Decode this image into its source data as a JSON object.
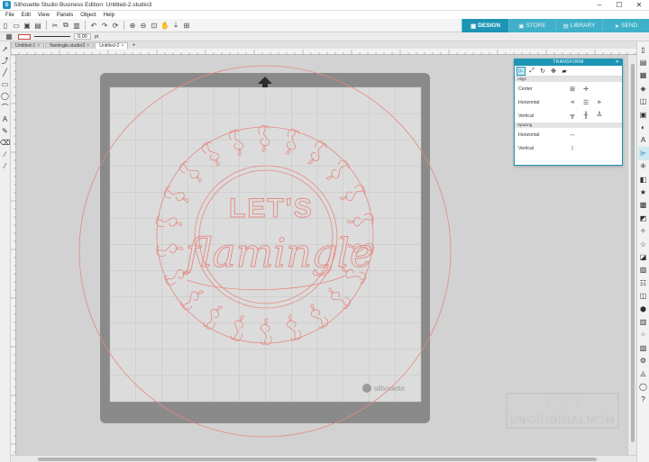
{
  "window": {
    "title": "Silhouette Studio Business Edition: Untitled-2.studio3",
    "controls": [
      "minimize",
      "maximize",
      "close"
    ]
  },
  "menu": [
    "File",
    "Edit",
    "View",
    "Panels",
    "Object",
    "Help"
  ],
  "mode_tabs": [
    {
      "label": "DESIGN",
      "active": true
    },
    {
      "label": "STORE",
      "active": false
    },
    {
      "label": "LIBRARY",
      "active": false
    },
    {
      "label": "SEND",
      "active": false
    }
  ],
  "line_options": {
    "line_width_value": "0.00",
    "unit": "pt"
  },
  "document_tabs": [
    {
      "label": "Untitled-1",
      "active": false
    },
    {
      "label": "flamingle.studio3",
      "active": false
    },
    {
      "label": "Untitled-2",
      "active": true
    }
  ],
  "transform_panel": {
    "title": "TRANSFORM",
    "sections": {
      "align": "Align",
      "spacing": "Spacing"
    },
    "rows": {
      "center": "Center",
      "horizontal": "Horizontal",
      "vertical": "Vertical",
      "space_horizontal": "Horizontal",
      "space_vertical": "Vertical"
    }
  },
  "design": {
    "text_top": "LET'S",
    "text_script": "flamingle",
    "mat_brand": "silhouette",
    "line_color": "#e48a82"
  },
  "watermark": "UNORIGINALMOM",
  "colors": {
    "accent": "#1d95b4",
    "tab_inactive": "#3fb0c9",
    "cut_line": "#e48a82",
    "mat": "#8a8a8a"
  }
}
